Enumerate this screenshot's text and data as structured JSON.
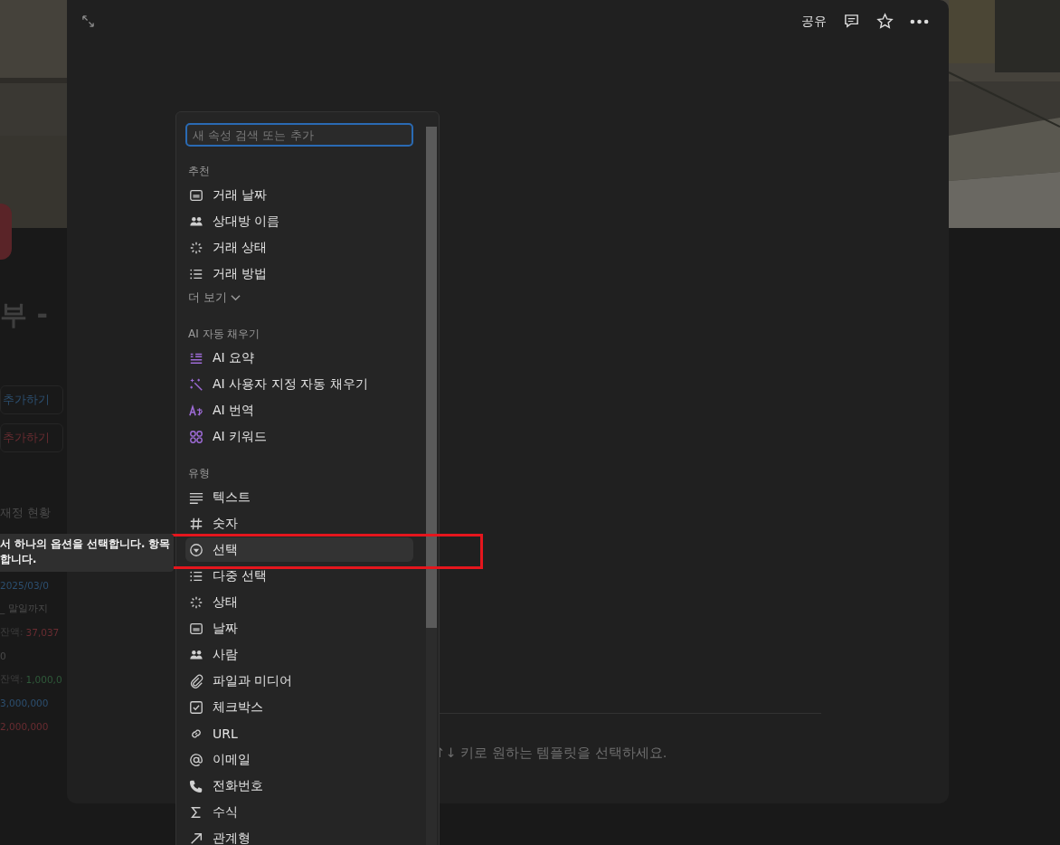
{
  "background_page": {
    "title": "부 -",
    "buttons": [
      {
        "label": "추가하기",
        "kind": "blue"
      },
      {
        "label": "추가하기",
        "kind": "red"
      }
    ],
    "section": "재정 현황",
    "lines": [
      {
        "kind": "blue",
        "text": "2025/03/0"
      },
      {
        "kind": "plain",
        "text": "_ 말일까지"
      },
      {
        "kind": "red",
        "label": "잔액:",
        "text": "37,037"
      },
      {
        "kind": "plain",
        "text": "0"
      },
      {
        "kind": "green",
        "label": "잔액:",
        "text": "1,000,0"
      },
      {
        "kind": "blue",
        "text": "3,000,000"
      },
      {
        "kind": "red",
        "text": "2,000,000"
      }
    ]
  },
  "tooltip": {
    "lines": [
      "서 하나의 옵션을 선택합니다. 항목",
      "합니다."
    ]
  },
  "modal": {
    "actions": {
      "share": "공유"
    },
    "hint": "↑↓ 키로 원하는 템플릿을 선택하세요."
  },
  "property_menu": {
    "search": {
      "placeholder": "새 속성 검색 또는 추가"
    },
    "sections": [
      {
        "heading": "추천",
        "items": [
          {
            "label": "거래 날짜",
            "kind": "calendar",
            "selected": false
          },
          {
            "label": "상대방 이름",
            "kind": "people",
            "selected": false
          },
          {
            "label": "거래 상태",
            "kind": "status",
            "selected": false
          },
          {
            "label": "거래 방법",
            "kind": "list",
            "selected": false
          }
        ],
        "more": "더 보기"
      },
      {
        "heading": "AI 자동 채우기",
        "items": [
          {
            "label": "AI 요약",
            "kind": "ai-summary",
            "selected": false
          },
          {
            "label": "AI 사용자 지정 자동 채우기",
            "kind": "ai-sparkle",
            "selected": false
          },
          {
            "label": "AI 번역",
            "kind": "ai-translate",
            "selected": false
          },
          {
            "label": "AI 키워드",
            "kind": "ai-keywords",
            "selected": false
          }
        ]
      },
      {
        "heading": "유형",
        "items": [
          {
            "label": "텍스트",
            "kind": "text",
            "selected": false
          },
          {
            "label": "숫자",
            "kind": "hash",
            "selected": false
          },
          {
            "label": "선택",
            "kind": "select",
            "selected": true
          },
          {
            "label": "다중 선택",
            "kind": "list",
            "selected": false
          },
          {
            "label": "상태",
            "kind": "status",
            "selected": false
          },
          {
            "label": "날짜",
            "kind": "calendar",
            "selected": false
          },
          {
            "label": "사람",
            "kind": "people",
            "selected": false
          },
          {
            "label": "파일과 미디어",
            "kind": "paperclip",
            "selected": false
          },
          {
            "label": "체크박스",
            "kind": "checkbox",
            "selected": false
          },
          {
            "label": "URL",
            "kind": "link",
            "selected": false
          },
          {
            "label": "이메일",
            "kind": "at",
            "selected": false
          },
          {
            "label": "전화번호",
            "kind": "phone",
            "selected": false
          },
          {
            "label": "수식",
            "kind": "sigma",
            "selected": false
          },
          {
            "label": "관계형",
            "kind": "arrow",
            "selected": false
          }
        ]
      }
    ]
  }
}
